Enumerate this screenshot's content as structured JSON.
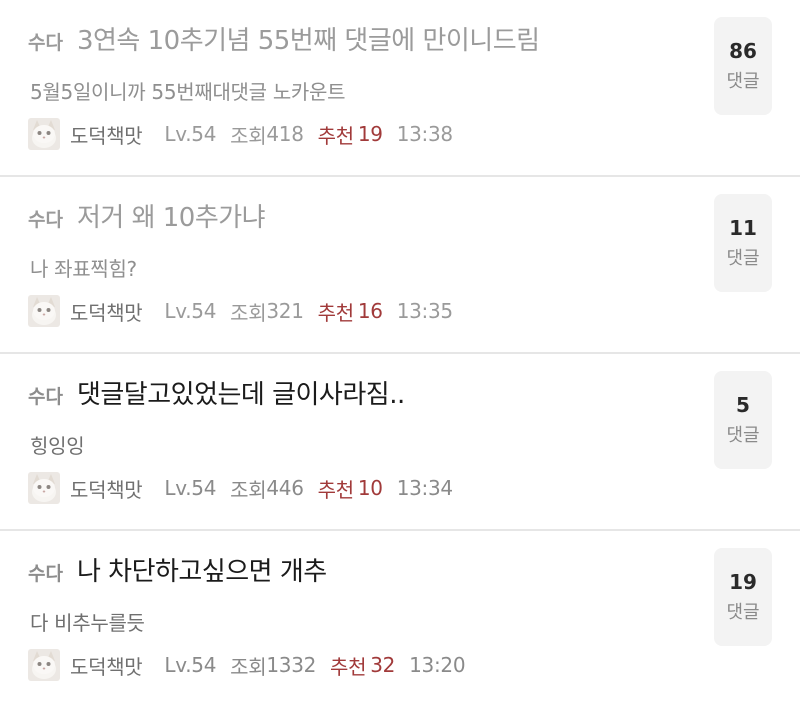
{
  "posts": [
    {
      "category": "수다",
      "title": "3연속 10추기념 55번째 댓글에 만이니드림",
      "preview": "5월5일이니까 55번째대댓글 노카운트",
      "author": "도덕책맛",
      "level": "Lv.54",
      "views_label": "조회",
      "views": "418",
      "recommend_label": "추천",
      "recommend": "19",
      "time": "13:38",
      "comments": "86",
      "comments_label": "댓글",
      "read": true
    },
    {
      "category": "수다",
      "title": "저거 왜 10추가냐",
      "preview": "나 좌표찍힘?",
      "author": "도덕책맛",
      "level": "Lv.54",
      "views_label": "조회",
      "views": "321",
      "recommend_label": "추천",
      "recommend": "16",
      "time": "13:35",
      "comments": "11",
      "comments_label": "댓글",
      "read": true
    },
    {
      "category": "수다",
      "title": "댓글달고있었는데 글이사라짐..",
      "preview": "힝잉잉",
      "author": "도덕책맛",
      "level": "Lv.54",
      "views_label": "조회",
      "views": "446",
      "recommend_label": "추천",
      "recommend": "10",
      "time": "13:34",
      "comments": "5",
      "comments_label": "댓글",
      "read": false
    },
    {
      "category": "수다",
      "title": "나 차단하고싶으면 개추",
      "preview": "다 비추누를듯",
      "author": "도덕책맛",
      "level": "Lv.54",
      "views_label": "조회",
      "views": "1332",
      "recommend_label": "추천",
      "recommend": "32",
      "time": "13:20",
      "comments": "19",
      "comments_label": "댓글",
      "read": false
    }
  ],
  "colors": {
    "recommend": "#a13a3a",
    "read_title": "#9b9b9b",
    "unread_title": "#1b1b1b",
    "comment_box_bg": "#f3f3f3",
    "divider": "#e6e6e6"
  }
}
